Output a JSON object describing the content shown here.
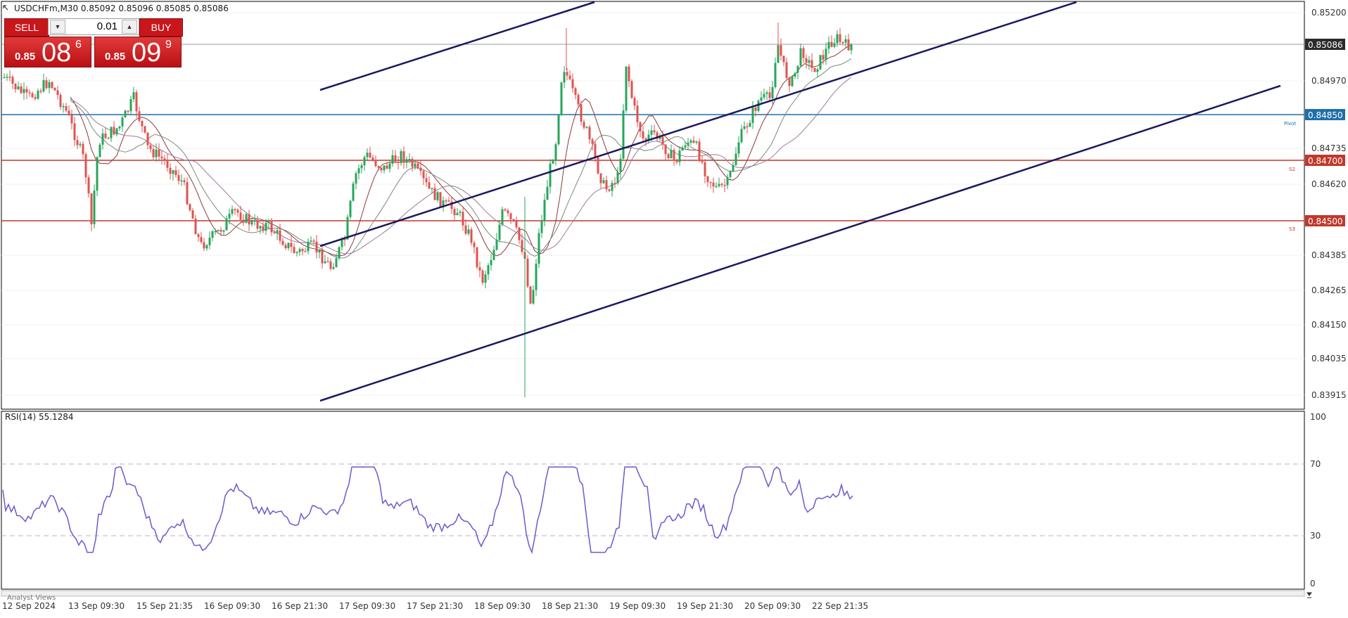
{
  "header": {
    "symbol_info": "USDCHFm,M30  0.85092 0.85096 0.85085 0.85086"
  },
  "trade_panel": {
    "sell_label": "SELL",
    "buy_label": "BUY",
    "lot": "0.01",
    "sell_price": {
      "prefix": "0.85",
      "big": "08",
      "sup": "6"
    },
    "buy_price": {
      "prefix": "0.85",
      "big": "09",
      "sup": "9"
    },
    "colors": {
      "button": "#c8161b",
      "price_box": "#d42a2f"
    }
  },
  "price_axis": {
    "ticks": [
      "0.85200",
      "0.84970",
      "0.84735",
      "0.84620",
      "0.84385",
      "0.84265",
      "0.84150",
      "0.84035",
      "0.83915"
    ],
    "current_price": "0.85086",
    "current_color": "#2b2b2b"
  },
  "levels": [
    {
      "name": "pivot",
      "price": "0.84850",
      "tag": "Pivot",
      "color": "#1f6fa8"
    },
    {
      "name": "s2",
      "price": "0.84700",
      "tag": "S2",
      "color": "#c0392b"
    },
    {
      "name": "s3",
      "price": "0.84500",
      "tag": "S3",
      "color": "#c0392b"
    }
  ],
  "rsi": {
    "label": "RSI(14) 55.1284",
    "ticks": [
      "100",
      "70",
      "30",
      "0"
    ],
    "line_color": "#6a5acd"
  },
  "time_axis": {
    "labels": [
      "12 Sep 2024",
      "13 Sep 09:30",
      "15 Sep 21:35",
      "16 Sep 09:30",
      "16 Sep 21:30",
      "17 Sep 09:30",
      "17 Sep 21:30",
      "18 Sep 09:30",
      "18 Sep 21:30",
      "19 Sep 09:30",
      "19 Sep 21:30",
      "20 Sep 09:30",
      "22 Sep 21:35"
    ]
  },
  "analyst_tab": "Analyst Views",
  "colors": {
    "bull": "#26a65b",
    "bear": "#e0524f",
    "channel": "#1a1a5e",
    "grid": "#e8e8e8"
  }
}
